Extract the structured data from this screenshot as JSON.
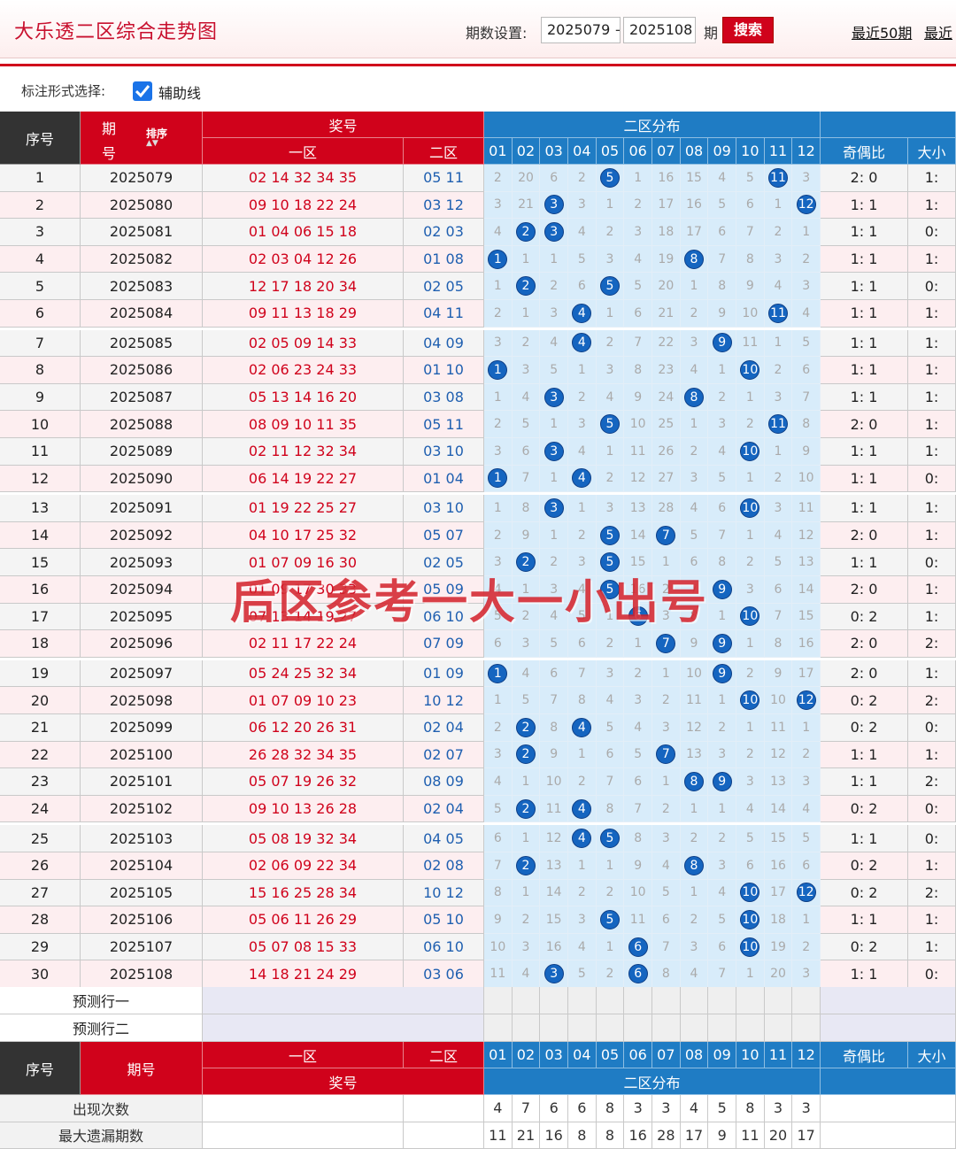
{
  "header": {
    "title": "大乐透二区综合走势图",
    "period_label": "期数设置:",
    "period_from": "2025079",
    "period_to": "2025108",
    "dash": "-",
    "period_unit": "期",
    "search_label": "搜索",
    "link_recent50": "最近50期",
    "link_recent_more": "最近"
  },
  "options": {
    "label": "标注形式选择:",
    "aux_line": "辅助线"
  },
  "table": {
    "head": {
      "seq": "序号",
      "issue_a": "期",
      "issue_b": "号",
      "sort": "排序",
      "prize": "奖号",
      "zone1": "一区",
      "zone2": "二区",
      "dist": "二区分布",
      "odd_even": "奇偶比",
      "big_small": "大小"
    },
    "balls": [
      "01",
      "02",
      "03",
      "04",
      "05",
      "06",
      "07",
      "08",
      "09",
      "10",
      "11",
      "12"
    ],
    "rows": [
      {
        "seq": "1",
        "issue": "2025079",
        "z1": "02 14 32 34 35",
        "z2": "05 11",
        "d": [
          "2",
          "20",
          "6",
          "2",
          "5",
          "1",
          "16",
          "15",
          "4",
          "5",
          "11",
          "3"
        ],
        "oe": "2: 0",
        "bs": "1:"
      },
      {
        "seq": "2",
        "issue": "2025080",
        "z1": "09 10 18 22 24",
        "z2": "03 12",
        "d": [
          "3",
          "21",
          "3",
          "3",
          "1",
          "2",
          "17",
          "16",
          "5",
          "6",
          "1",
          "12"
        ],
        "oe": "1: 1",
        "bs": "1:"
      },
      {
        "seq": "3",
        "issue": "2025081",
        "z1": "01 04 06 15 18",
        "z2": "02 03",
        "d": [
          "4",
          "2",
          "3",
          "4",
          "2",
          "3",
          "18",
          "17",
          "6",
          "7",
          "2",
          "1"
        ],
        "oe": "1: 1",
        "bs": "0:"
      },
      {
        "seq": "4",
        "issue": "2025082",
        "z1": "02 03 04 12 26",
        "z2": "01 08",
        "d": [
          "1",
          "1",
          "1",
          "5",
          "3",
          "4",
          "19",
          "8",
          "7",
          "8",
          "3",
          "2"
        ],
        "oe": "1: 1",
        "bs": "1:"
      },
      {
        "seq": "5",
        "issue": "2025083",
        "z1": "12 17 18 20 34",
        "z2": "02 05",
        "d": [
          "1",
          "2",
          "2",
          "6",
          "5",
          "5",
          "20",
          "1",
          "8",
          "9",
          "4",
          "3"
        ],
        "oe": "1: 1",
        "bs": "0:"
      },
      {
        "seq": "6",
        "issue": "2025084",
        "z1": "09 11 13 18 29",
        "z2": "04 11",
        "d": [
          "2",
          "1",
          "3",
          "4",
          "1",
          "6",
          "21",
          "2",
          "9",
          "10",
          "11",
          "4"
        ],
        "oe": "1: 1",
        "bs": "1:"
      },
      {
        "seq": "7",
        "issue": "2025085",
        "z1": "02 05 09 14 33",
        "z2": "04 09",
        "d": [
          "3",
          "2",
          "4",
          "4",
          "2",
          "7",
          "22",
          "3",
          "9",
          "11",
          "1",
          "5"
        ],
        "oe": "1: 1",
        "bs": "1:"
      },
      {
        "seq": "8",
        "issue": "2025086",
        "z1": "02 06 23 24 33",
        "z2": "01 10",
        "d": [
          "1",
          "3",
          "5",
          "1",
          "3",
          "8",
          "23",
          "4",
          "1",
          "10",
          "2",
          "6"
        ],
        "oe": "1: 1",
        "bs": "1:"
      },
      {
        "seq": "9",
        "issue": "2025087",
        "z1": "05 13 14 16 20",
        "z2": "03 08",
        "d": [
          "1",
          "4",
          "3",
          "2",
          "4",
          "9",
          "24",
          "8",
          "2",
          "1",
          "3",
          "7"
        ],
        "oe": "1: 1",
        "bs": "1:"
      },
      {
        "seq": "10",
        "issue": "2025088",
        "z1": "08 09 10 11 35",
        "z2": "05 11",
        "d": [
          "2",
          "5",
          "1",
          "3",
          "5",
          "10",
          "25",
          "1",
          "3",
          "2",
          "11",
          "8"
        ],
        "oe": "2: 0",
        "bs": "1:"
      },
      {
        "seq": "11",
        "issue": "2025089",
        "z1": "02 11 12 32 34",
        "z2": "03 10",
        "d": [
          "3",
          "6",
          "3",
          "4",
          "1",
          "11",
          "26",
          "2",
          "4",
          "10",
          "1",
          "9"
        ],
        "oe": "1: 1",
        "bs": "1:"
      },
      {
        "seq": "12",
        "issue": "2025090",
        "z1": "06 14 19 22 27",
        "z2": "01 04",
        "d": [
          "1",
          "7",
          "1",
          "4",
          "2",
          "12",
          "27",
          "3",
          "5",
          "1",
          "2",
          "10"
        ],
        "oe": "1: 1",
        "bs": "0:"
      },
      {
        "seq": "13",
        "issue": "2025091",
        "z1": "01 19 22 25 27",
        "z2": "03 10",
        "d": [
          "1",
          "8",
          "3",
          "1",
          "3",
          "13",
          "28",
          "4",
          "6",
          "10",
          "3",
          "11"
        ],
        "oe": "1: 1",
        "bs": "1:"
      },
      {
        "seq": "14",
        "issue": "2025092",
        "z1": "04 10 17 25 32",
        "z2": "05 07",
        "d": [
          "2",
          "9",
          "1",
          "2",
          "5",
          "14",
          "7",
          "5",
          "7",
          "1",
          "4",
          "12"
        ],
        "oe": "2: 0",
        "bs": "1:"
      },
      {
        "seq": "15",
        "issue": "2025093",
        "z1": "01 07 09 16 30",
        "z2": "02 05",
        "d": [
          "3",
          "2",
          "2",
          "3",
          "5",
          "15",
          "1",
          "6",
          "8",
          "2",
          "5",
          "13"
        ],
        "oe": "1: 1",
        "bs": "0:"
      },
      {
        "seq": "16",
        "issue": "2025094",
        "z1": "01 09 17 30 33",
        "z2": "05 09",
        "d": [
          "4",
          "1",
          "3",
          "4",
          "5",
          "16",
          "2",
          "7",
          "9",
          "3",
          "6",
          "14"
        ],
        "oe": "2: 0",
        "bs": "1:"
      },
      {
        "seq": "17",
        "issue": "2025095",
        "z1": "07 13 14 19 27",
        "z2": "06 10",
        "d": [
          "5",
          "2",
          "4",
          "5",
          "1",
          "6",
          "3",
          "8",
          "1",
          "10",
          "7",
          "15"
        ],
        "oe": "0: 2",
        "bs": "1:"
      },
      {
        "seq": "18",
        "issue": "2025096",
        "z1": "02 11 17 22 24",
        "z2": "07 09",
        "d": [
          "6",
          "3",
          "5",
          "6",
          "2",
          "1",
          "7",
          "9",
          "9",
          "1",
          "8",
          "16"
        ],
        "oe": "2: 0",
        "bs": "2:"
      },
      {
        "seq": "19",
        "issue": "2025097",
        "z1": "05 24 25 32 34",
        "z2": "01 09",
        "d": [
          "1",
          "4",
          "6",
          "7",
          "3",
          "2",
          "1",
          "10",
          "9",
          "2",
          "9",
          "17"
        ],
        "oe": "2: 0",
        "bs": "1:"
      },
      {
        "seq": "20",
        "issue": "2025098",
        "z1": "01 07 09 10 23",
        "z2": "10 12",
        "d": [
          "1",
          "5",
          "7",
          "8",
          "4",
          "3",
          "2",
          "11",
          "1",
          "10",
          "10",
          "12"
        ],
        "oe": "0: 2",
        "bs": "2:"
      },
      {
        "seq": "21",
        "issue": "2025099",
        "z1": "06 12 20 26 31",
        "z2": "02 04",
        "d": [
          "2",
          "2",
          "8",
          "4",
          "5",
          "4",
          "3",
          "12",
          "2",
          "1",
          "11",
          "1"
        ],
        "oe": "0: 2",
        "bs": "0:"
      },
      {
        "seq": "22",
        "issue": "2025100",
        "z1": "26 28 32 34 35",
        "z2": "02 07",
        "d": [
          "3",
          "2",
          "9",
          "1",
          "6",
          "5",
          "7",
          "13",
          "3",
          "2",
          "12",
          "2"
        ],
        "oe": "1: 1",
        "bs": "1:"
      },
      {
        "seq": "23",
        "issue": "2025101",
        "z1": "05 07 19 26 32",
        "z2": "08 09",
        "d": [
          "4",
          "1",
          "10",
          "2",
          "7",
          "6",
          "1",
          "8",
          "9",
          "3",
          "13",
          "3"
        ],
        "oe": "1: 1",
        "bs": "2:"
      },
      {
        "seq": "24",
        "issue": "2025102",
        "z1": "09 10 13 26 28",
        "z2": "02 04",
        "d": [
          "5",
          "2",
          "11",
          "4",
          "8",
          "7",
          "2",
          "1",
          "1",
          "4",
          "14",
          "4"
        ],
        "oe": "0: 2",
        "bs": "0:"
      },
      {
        "seq": "25",
        "issue": "2025103",
        "z1": "05 08 19 32 34",
        "z2": "04 05",
        "d": [
          "6",
          "1",
          "12",
          "4",
          "5",
          "8",
          "3",
          "2",
          "2",
          "5",
          "15",
          "5"
        ],
        "oe": "1: 1",
        "bs": "0:"
      },
      {
        "seq": "26",
        "issue": "2025104",
        "z1": "02 06 09 22 34",
        "z2": "02 08",
        "d": [
          "7",
          "2",
          "13",
          "1",
          "1",
          "9",
          "4",
          "8",
          "3",
          "6",
          "16",
          "6"
        ],
        "oe": "0: 2",
        "bs": "1:"
      },
      {
        "seq": "27",
        "issue": "2025105",
        "z1": "15 16 25 28 34",
        "z2": "10 12",
        "d": [
          "8",
          "1",
          "14",
          "2",
          "2",
          "10",
          "5",
          "1",
          "4",
          "10",
          "17",
          "12"
        ],
        "oe": "0: 2",
        "bs": "2:"
      },
      {
        "seq": "28",
        "issue": "2025106",
        "z1": "05 06 11 26 29",
        "z2": "05 10",
        "d": [
          "9",
          "2",
          "15",
          "3",
          "5",
          "11",
          "6",
          "2",
          "5",
          "10",
          "18",
          "1"
        ],
        "oe": "1: 1",
        "bs": "1:"
      },
      {
        "seq": "29",
        "issue": "2025107",
        "z1": "05 07 08 15 33",
        "z2": "06 10",
        "d": [
          "10",
          "3",
          "16",
          "4",
          "1",
          "6",
          "7",
          "3",
          "6",
          "10",
          "19",
          "2"
        ],
        "oe": "0: 2",
        "bs": "1:"
      },
      {
        "seq": "30",
        "issue": "2025108",
        "z1": "14 18 21 24 29",
        "z2": "03 06",
        "d": [
          "11",
          "4",
          "3",
          "5",
          "2",
          "6",
          "8",
          "4",
          "7",
          "1",
          "20",
          "3"
        ],
        "oe": "1: 1",
        "bs": "0:"
      }
    ],
    "predict": [
      "预测行一",
      "预测行二"
    ],
    "stats": [
      {
        "label": "出现次数",
        "values": [
          "4",
          "7",
          "6",
          "6",
          "8",
          "3",
          "3",
          "4",
          "5",
          "8",
          "3",
          "3"
        ]
      },
      {
        "label": "最大遗漏期数",
        "values": [
          "11",
          "21",
          "16",
          "8",
          "8",
          "16",
          "28",
          "17",
          "9",
          "11",
          "20",
          "17"
        ]
      }
    ]
  },
  "watermark": "后区参考一大一小出号",
  "colors": {
    "brand_red": "#d0021b",
    "header_dark": "#333333",
    "dist_blue": "#1f7cc4",
    "ball_blue": "#1565c0",
    "dist_cell_bg": "#d8ecfa",
    "row_pink": "#fdeef0"
  }
}
